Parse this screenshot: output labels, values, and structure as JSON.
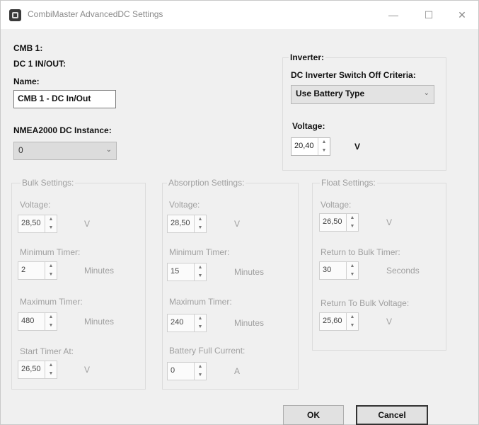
{
  "window": {
    "title": "CombiMaster AdvancedDC Settings",
    "minimize": "—",
    "maximize": "☐",
    "close": "✕"
  },
  "device": {
    "line1": "CMB 1:",
    "line2": "DC 1 IN/OUT:",
    "name_label": "Name:",
    "name_value": "CMB 1 - DC In/Out",
    "nmea_label": "NMEA2000 DC Instance:",
    "nmea_value": "0"
  },
  "inverter": {
    "group_title": "Inverter:",
    "criteria_label": "DC Inverter Switch Off Criteria:",
    "criteria_value": "Use Battery Type",
    "voltage_label": "Voltage:",
    "voltage_value": "20,40",
    "voltage_unit": "V"
  },
  "bulk": {
    "group_title": "Bulk Settings:",
    "voltage_label": "Voltage:",
    "voltage_value": "28,50",
    "voltage_unit": "V",
    "min_timer_label": "Minimum Timer:",
    "min_timer_value": "2",
    "min_timer_unit": "Minutes",
    "max_timer_label": "Maximum Timer:",
    "max_timer_value": "480",
    "max_timer_unit": "Minutes",
    "start_label": "Start Timer At:",
    "start_value": "26,50",
    "start_unit": "V"
  },
  "absorption": {
    "group_title": "Absorption Settings:",
    "voltage_label": "Voltage:",
    "voltage_value": "28,50",
    "voltage_unit": "V",
    "min_timer_label": "Minimum Timer:",
    "min_timer_value": "15",
    "min_timer_unit": "Minutes",
    "max_timer_label": "Maximum Timer:",
    "max_timer_value": "240",
    "max_timer_unit": "Minutes",
    "current_label": "Battery Full Current:",
    "current_value": "0",
    "current_unit": "A"
  },
  "float": {
    "group_title": "Float Settings:",
    "voltage_label": "Voltage:",
    "voltage_value": "26,50",
    "voltage_unit": "V",
    "rb_timer_label": "Return to Bulk Timer:",
    "rb_timer_value": "30",
    "rb_timer_unit": "Seconds",
    "rb_voltage_label": "Return To Bulk Voltage:",
    "rb_voltage_value": "25,60",
    "rb_voltage_unit": "V"
  },
  "buttons": {
    "ok": "OK",
    "cancel": "Cancel"
  },
  "spin": {
    "up": "▲",
    "down": "▼"
  },
  "combo_arrow": "⌄"
}
